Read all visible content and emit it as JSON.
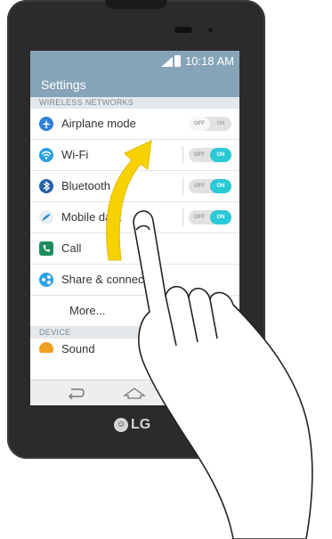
{
  "status_bar": {
    "time": "10:18 AM"
  },
  "app_bar": {
    "title": "Settings"
  },
  "sections": {
    "wireless": "WIRELESS NETWORKS",
    "device": "DEVICE"
  },
  "rows": [
    {
      "label": "Airplane mode",
      "icon": "airplane-icon",
      "color": "#2f7fd6",
      "toggle": "off"
    },
    {
      "label": "Wi-Fi",
      "icon": "wifi-icon",
      "color": "#2a9ee0",
      "toggle": "on"
    },
    {
      "label": "Bluetooth",
      "icon": "bluetooth-icon",
      "color": "#2561a8",
      "toggle": "on"
    },
    {
      "label": "Mobile data",
      "icon": "mobile-data-icon",
      "color": "#2c8fd8",
      "toggle": "on"
    },
    {
      "label": "Call",
      "icon": "call-icon",
      "color": "#1f8c5d"
    },
    {
      "label": "Share & connect",
      "icon": "share-connect-icon",
      "color": "#2aa0e6"
    },
    {
      "label": "More..."
    }
  ],
  "device_rows": [
    {
      "label": "Sound",
      "icon": "sound-icon",
      "color": "#f0a020"
    }
  ],
  "toggle_text": {
    "off": "OFF",
    "on": "ON"
  },
  "logo": {
    "text": "LG"
  },
  "colors": {
    "accent": "#86a4b7",
    "toggle_on": "#29c9d6",
    "gesture_arrow": "#f7d100"
  }
}
